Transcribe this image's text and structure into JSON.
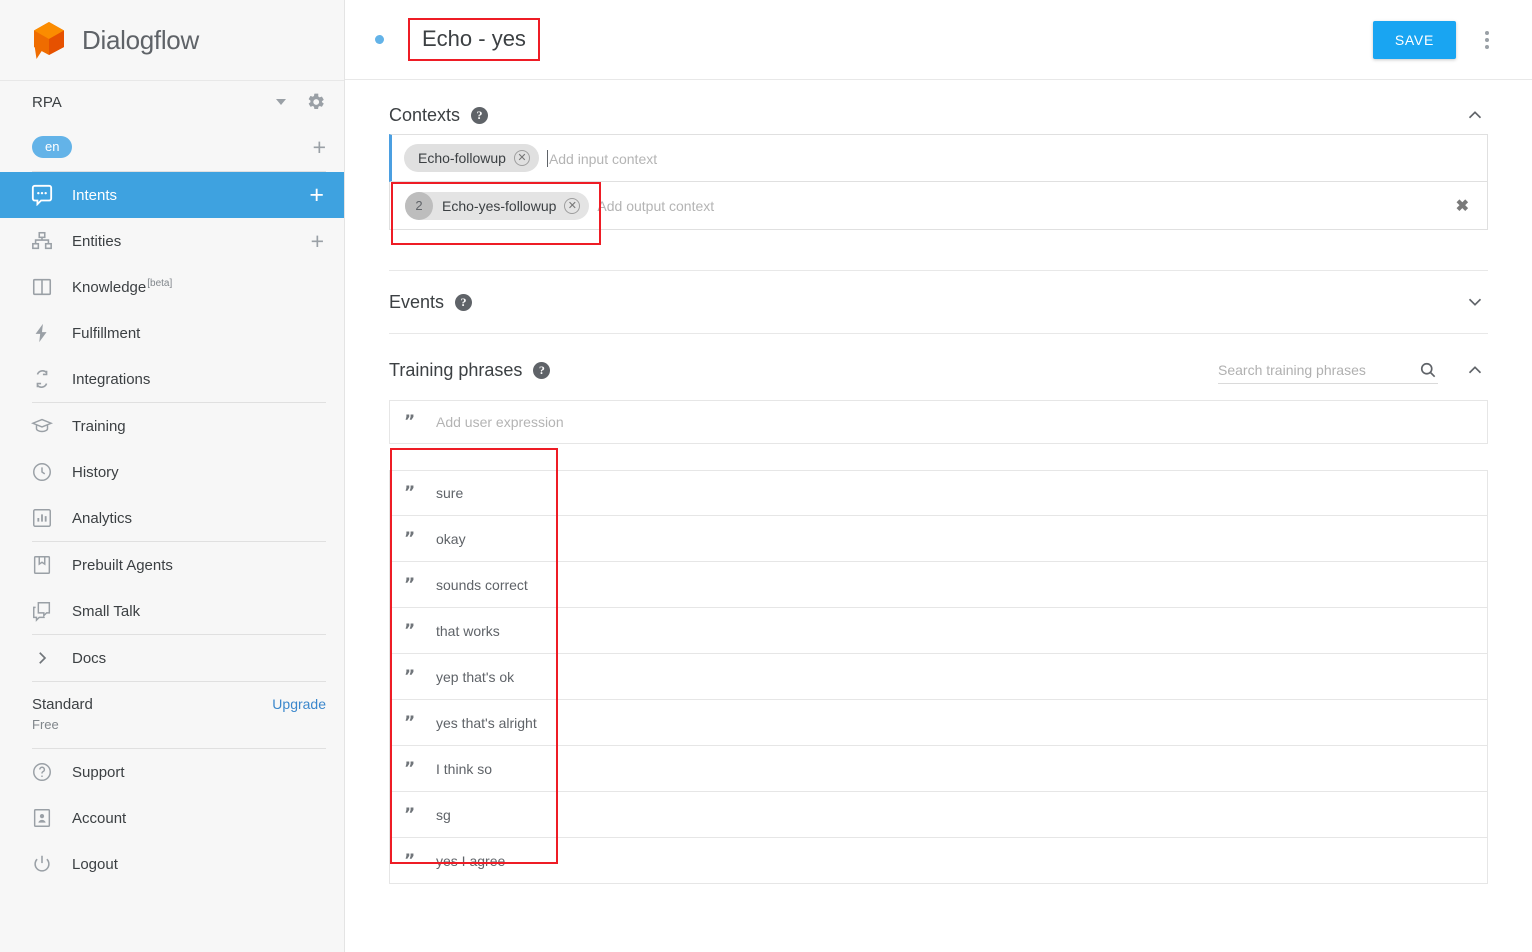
{
  "brand": {
    "name": "Dialogflow",
    "logo_icon": "dialogflow-cube-logo"
  },
  "sidebar": {
    "agent": {
      "name": "RPA",
      "dropdown_icon": "caret-down-icon",
      "settings_icon": "gear-icon"
    },
    "language": {
      "code": "en",
      "add_icon": "plus-icon"
    },
    "nav": [
      {
        "label": "Intents",
        "icon": "chat-bubble-icon",
        "active": true,
        "add": "+"
      },
      {
        "label": "Entities",
        "icon": "entity-tree-icon",
        "active": false,
        "add": "+"
      },
      {
        "label": "Knowledge",
        "icon": "book-icon",
        "active": false,
        "badge": "[beta]"
      },
      {
        "label": "Fulfillment",
        "icon": "lightning-bolt-icon",
        "active": false
      },
      {
        "label": "Integrations",
        "icon": "sync-arrows-icon",
        "active": false
      }
    ],
    "nav_group2": [
      {
        "label": "Training",
        "icon": "graduation-cap-icon"
      },
      {
        "label": "History",
        "icon": "clock-icon"
      },
      {
        "label": "Analytics",
        "icon": "bar-chart-icon"
      }
    ],
    "nav_group3": [
      {
        "label": "Prebuilt Agents",
        "icon": "agents-book-icon"
      },
      {
        "label": "Small Talk",
        "icon": "speech-bubbles-icon"
      }
    ],
    "docs": {
      "label": "Docs",
      "icon": "chevron-right-icon"
    },
    "plan": {
      "title": "Standard",
      "subtitle": "Free",
      "upgrade_label": "Upgrade"
    },
    "nav_group4": [
      {
        "label": "Support",
        "icon": "question-circle-icon"
      },
      {
        "label": "Account",
        "icon": "account-card-icon"
      },
      {
        "label": "Logout",
        "icon": "power-icon"
      }
    ]
  },
  "topbar": {
    "status_dot": "unsaved-dot",
    "intent_title": "Echo - yes",
    "save_label": "SAVE",
    "menu_icon": "kebab-menu-icon"
  },
  "contexts": {
    "title": "Contexts",
    "help_icon": "help-icon",
    "collapse_icon": "chevron-up-icon",
    "input": {
      "chip_label": "Echo-followup",
      "remove_icon": "chip-remove-icon",
      "placeholder": "Add input context"
    },
    "output": {
      "count": "2",
      "chip_label": "Echo-yes-followup",
      "remove_icon": "chip-remove-icon",
      "placeholder": "Add output context",
      "delete_icon": "delete-x-icon"
    }
  },
  "events": {
    "title": "Events",
    "help_icon": "help-icon",
    "expand_icon": "chevron-down-icon"
  },
  "training_phrases": {
    "title": "Training phrases",
    "help_icon": "help-icon",
    "collapse_icon": "chevron-up-icon",
    "search_placeholder": "Search training phrases",
    "search_value": "",
    "search_icon": "search-icon",
    "add_placeholder": "Add user expression",
    "quote_icon": "quote-mark-icon",
    "items": [
      "sure",
      "okay",
      "sounds correct",
      "that works",
      "yep that's ok",
      "yes that's alright",
      "I think so",
      "sg",
      "yes I agree"
    ]
  },
  "annotations": {
    "color": "#ee1c25",
    "boxes": [
      "intent-title",
      "output-context-chip",
      "training-phrase-list"
    ]
  },
  "colors": {
    "accent_blue": "#3ea2e0",
    "save_blue": "#19a5f2",
    "brand_orange": "#f08000",
    "annotation_red": "#ee1c25",
    "sidebar_bg": "#f7f7f7"
  }
}
